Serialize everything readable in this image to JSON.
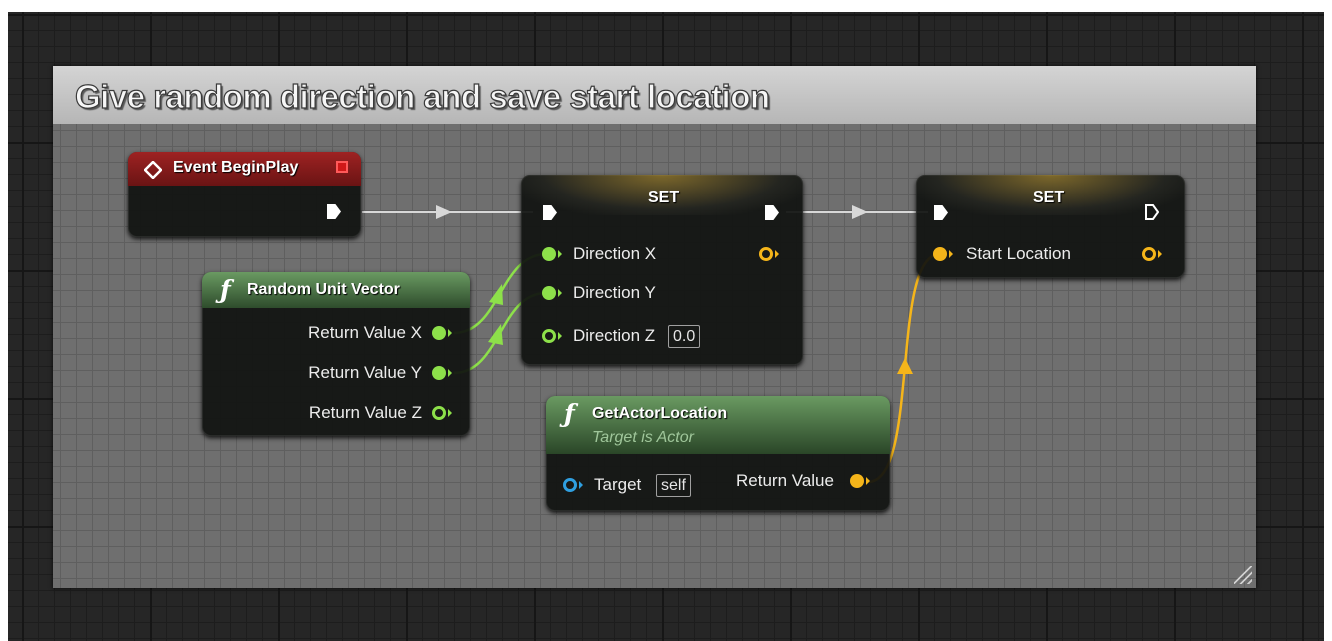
{
  "comment": {
    "title": "Give random direction and save start location"
  },
  "nodes": {
    "begin_play": {
      "title": "Event BeginPlay"
    },
    "random_unit_vector": {
      "title": "Random Unit Vector",
      "outputs": [
        "Return Value X",
        "Return Value Y",
        "Return Value Z"
      ]
    },
    "set_direction": {
      "title": "SET",
      "inputs": [
        "Direction X",
        "Direction Y",
        "Direction Z"
      ],
      "direction_z_value": "0.0"
    },
    "get_actor_location": {
      "title": "GetActorLocation",
      "subtitle": "Target is Actor",
      "target_label": "Target",
      "target_value": "self",
      "return_label": "Return Value"
    },
    "set_start_location": {
      "title": "SET",
      "input": "Start Location"
    }
  },
  "colors": {
    "exec": "#ffffff",
    "float_pin": "#8de04a",
    "vector_pin": "#f5b51a",
    "object_pin": "#2f9fe0",
    "event_header": "#8a1c1c",
    "function_header": "#3e6a3a"
  },
  "icons": {
    "event": "diamond-event-icon",
    "function": "function-f-icon",
    "delegate": "red-square-delegate-icon"
  }
}
